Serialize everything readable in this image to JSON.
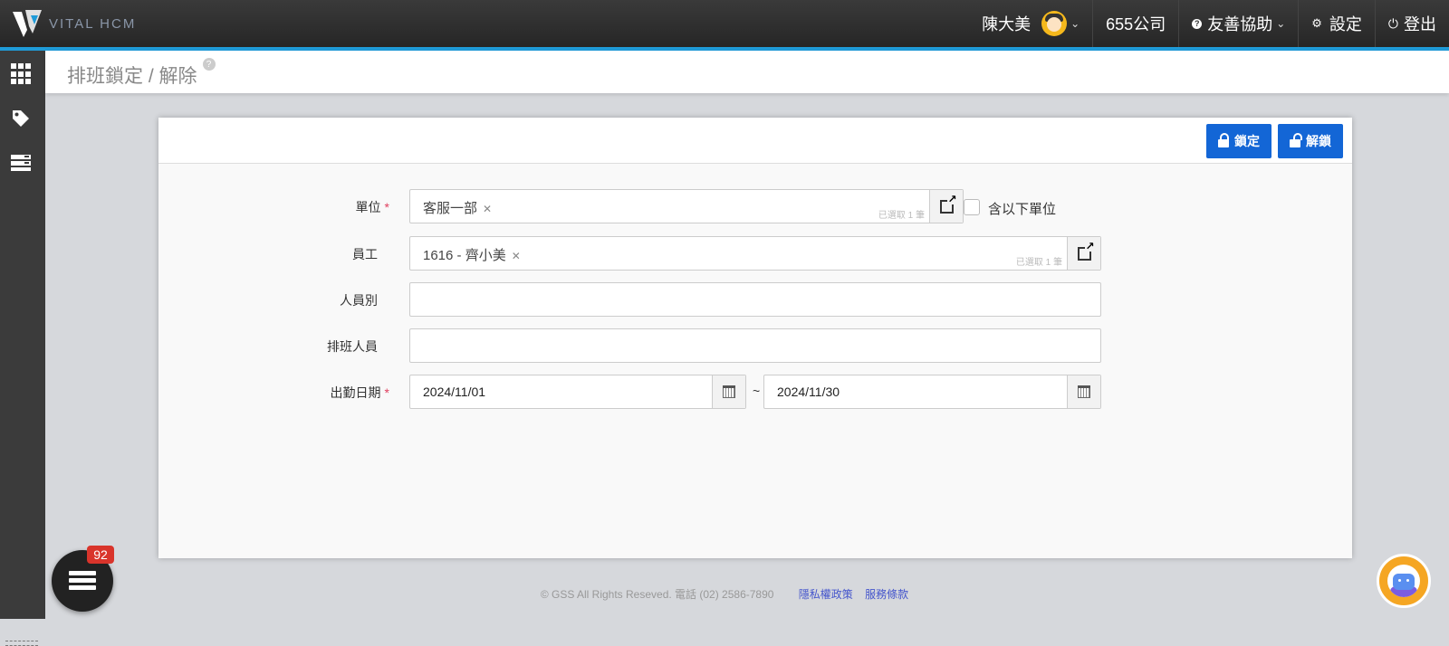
{
  "app": {
    "brand": "VITAL HCM"
  },
  "topbar": {
    "user_name": "陳大美",
    "company": "655公司",
    "help": "友善協助",
    "settings": "設定",
    "logout": "登出"
  },
  "page": {
    "title": "排班鎖定 / 解除"
  },
  "toolbar": {
    "lock_label": "鎖定",
    "unlock_label": "解鎖"
  },
  "form": {
    "unit": {
      "label": "單位",
      "tag": "客服一部",
      "count": "已選取 1 筆",
      "include_sub": "含以下單位"
    },
    "employee": {
      "label": "員工",
      "tag": "1616 - 齊小美",
      "count": "已選取 1 筆"
    },
    "person_type": {
      "label": "人員別",
      "value": ""
    },
    "scheduler": {
      "label": "排班人員",
      "value": ""
    },
    "date": {
      "label": "出勤日期",
      "from": "2024/11/01",
      "to": "2024/11/30",
      "sep": "~"
    }
  },
  "footer": {
    "copyright": "© GSS All Rights Reseved. 電話 (02) 2586-7890",
    "privacy": "隱私權政策",
    "terms": "服務條款"
  },
  "fab": {
    "badge": "92"
  }
}
